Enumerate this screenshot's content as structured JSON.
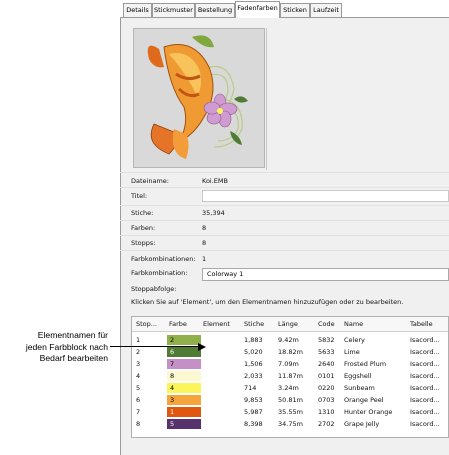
{
  "tabs": [
    "Details",
    "Stickmuster",
    "Bestellung",
    "Fadenfarben",
    "Sticken",
    "Laufzeit"
  ],
  "active_tab": 3,
  "fields": {
    "dateiname_label": "Dateiname:",
    "dateiname_value": "Koi.EMB",
    "titel_label": "Titel:",
    "stiche_label": "Stiche:",
    "stiche_value": "35,394",
    "farben_label": "Farben:",
    "farben_value": "8",
    "stopps_label": "Stopps:",
    "stopps_value": "8",
    "farbkombinationen_label": "Farbkombinationen:",
    "farbkombinationen_value": "1",
    "farbkombination_label": "Farbkombination:",
    "farbkombination_value": "Colorway 1",
    "stoppabfolge_label": "Stoppabfolge:"
  },
  "instruction": "Klicken Sie auf 'Element', um den Elementnamen hinzuzufügen oder zu bearbeiten.",
  "table": {
    "headers": [
      "Stop...",
      "Farbe",
      "Element",
      "Stiche",
      "Länge",
      "Code",
      "Name",
      "Tabelle"
    ],
    "rows": [
      {
        "stop": "1",
        "farbe": "2",
        "color": "#8fb04a",
        "element": "",
        "stiche": "1,883",
        "laenge": "9.42m",
        "code": "5832",
        "name": "Celery",
        "tabelle": "Isacord..."
      },
      {
        "stop": "2",
        "farbe": "6",
        "color": "#4f7b35",
        "element": "",
        "stiche": "5,020",
        "laenge": "18.82m",
        "code": "5633",
        "name": "Lime",
        "tabelle": "Isacord..."
      },
      {
        "stop": "3",
        "farbe": "7",
        "color": "#c490c6",
        "element": "",
        "stiche": "1,506",
        "laenge": "7.09m",
        "code": "2640",
        "name": "Frosted Plum",
        "tabelle": "Isacord..."
      },
      {
        "stop": "4",
        "farbe": "8",
        "color": "#fbf7cf",
        "element": "",
        "stiche": "2,033",
        "laenge": "11.87m",
        "code": "0101",
        "name": "Eggshell",
        "tabelle": "Isacord..."
      },
      {
        "stop": "5",
        "farbe": "4",
        "color": "#fcf55a",
        "element": "",
        "stiche": "714",
        "laenge": "3.24m",
        "code": "0220",
        "name": "Sunbeam",
        "tabelle": "Isacord..."
      },
      {
        "stop": "6",
        "farbe": "3",
        "color": "#f6a53c",
        "element": "",
        "stiche": "9,853",
        "laenge": "50.81m",
        "code": "0703",
        "name": "Orange Peel",
        "tabelle": "Isacord..."
      },
      {
        "stop": "7",
        "farbe": "1",
        "color": "#e0580f",
        "element": "",
        "stiche": "5,987",
        "laenge": "35.55m",
        "code": "1310",
        "name": "Hunter Orange",
        "tabelle": "Isacord..."
      },
      {
        "stop": "8",
        "farbe": "5",
        "color": "#57326d",
        "element": "",
        "stiche": "8,398",
        "laenge": "34.75m",
        "code": "2702",
        "name": "Grape Jelly",
        "tabelle": "Isacord..."
      }
    ]
  },
  "callout": {
    "line1": "Elementnamen für",
    "line2": "jeden Farbblock nach",
    "line3": "Bedarf bearbeiten"
  },
  "preview": {
    "icon": "koi-fish-embroidery-image"
  }
}
